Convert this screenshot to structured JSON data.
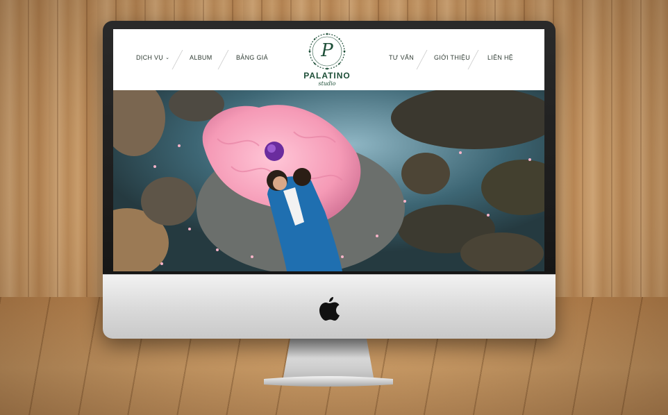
{
  "nav": {
    "left_items": [
      {
        "label": "DỊCH VỤ",
        "has_dropdown": true
      },
      {
        "label": "ALBUM"
      },
      {
        "label": "BẢNG GIÁ"
      }
    ],
    "right_items": [
      {
        "label": "TƯ VẤN"
      },
      {
        "label": "GIỚI THIỆU"
      },
      {
        "label": "LIÊN HỆ"
      }
    ]
  },
  "logo": {
    "monogram": "P",
    "name": "PALATINO",
    "subtitle": "studio"
  },
  "colors": {
    "brand_green": "#1d4e37",
    "nav_text": "#2f3b33"
  },
  "icons": {
    "dropdown": "chevron-down-icon",
    "device": "apple-logo-icon"
  }
}
